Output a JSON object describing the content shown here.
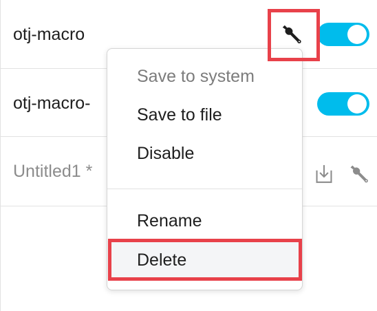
{
  "rows": [
    {
      "name": "otj-macro",
      "enabled": true
    },
    {
      "name": "otj-macro-",
      "enabled": true
    },
    {
      "name": "Untitled1 *",
      "enabled": false
    }
  ],
  "icons": {
    "wrench": "wrench-icon",
    "download": "download-icon"
  },
  "menu": {
    "items": [
      {
        "label": "Save to system",
        "disabled": true
      },
      {
        "label": "Save to file",
        "disabled": false
      },
      {
        "label": "Disable",
        "disabled": false
      },
      {
        "label": "Rename",
        "disabled": false
      },
      {
        "label": "Delete",
        "disabled": false,
        "hovered": true
      }
    ]
  },
  "colors": {
    "accent": "#00bcec",
    "highlight": "#e8414a",
    "text": "#1e1e1e",
    "muted": "#8c8c8c"
  }
}
